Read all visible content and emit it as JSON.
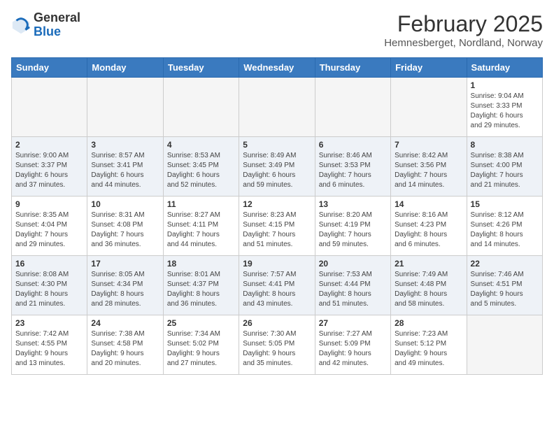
{
  "header": {
    "logo_general": "General",
    "logo_blue": "Blue",
    "month_title": "February 2025",
    "location": "Hemnesberget, Nordland, Norway"
  },
  "calendar": {
    "days_of_week": [
      "Sunday",
      "Monday",
      "Tuesday",
      "Wednesday",
      "Thursday",
      "Friday",
      "Saturday"
    ],
    "weeks": [
      [
        {
          "day": "",
          "info": ""
        },
        {
          "day": "",
          "info": ""
        },
        {
          "day": "",
          "info": ""
        },
        {
          "day": "",
          "info": ""
        },
        {
          "day": "",
          "info": ""
        },
        {
          "day": "",
          "info": ""
        },
        {
          "day": "1",
          "info": "Sunrise: 9:04 AM\nSunset: 3:33 PM\nDaylight: 6 hours\nand 29 minutes."
        }
      ],
      [
        {
          "day": "2",
          "info": "Sunrise: 9:00 AM\nSunset: 3:37 PM\nDaylight: 6 hours\nand 37 minutes."
        },
        {
          "day": "3",
          "info": "Sunrise: 8:57 AM\nSunset: 3:41 PM\nDaylight: 6 hours\nand 44 minutes."
        },
        {
          "day": "4",
          "info": "Sunrise: 8:53 AM\nSunset: 3:45 PM\nDaylight: 6 hours\nand 52 minutes."
        },
        {
          "day": "5",
          "info": "Sunrise: 8:49 AM\nSunset: 3:49 PM\nDaylight: 6 hours\nand 59 minutes."
        },
        {
          "day": "6",
          "info": "Sunrise: 8:46 AM\nSunset: 3:53 PM\nDaylight: 7 hours\nand 6 minutes."
        },
        {
          "day": "7",
          "info": "Sunrise: 8:42 AM\nSunset: 3:56 PM\nDaylight: 7 hours\nand 14 minutes."
        },
        {
          "day": "8",
          "info": "Sunrise: 8:38 AM\nSunset: 4:00 PM\nDaylight: 7 hours\nand 21 minutes."
        }
      ],
      [
        {
          "day": "9",
          "info": "Sunrise: 8:35 AM\nSunset: 4:04 PM\nDaylight: 7 hours\nand 29 minutes."
        },
        {
          "day": "10",
          "info": "Sunrise: 8:31 AM\nSunset: 4:08 PM\nDaylight: 7 hours\nand 36 minutes."
        },
        {
          "day": "11",
          "info": "Sunrise: 8:27 AM\nSunset: 4:11 PM\nDaylight: 7 hours\nand 44 minutes."
        },
        {
          "day": "12",
          "info": "Sunrise: 8:23 AM\nSunset: 4:15 PM\nDaylight: 7 hours\nand 51 minutes."
        },
        {
          "day": "13",
          "info": "Sunrise: 8:20 AM\nSunset: 4:19 PM\nDaylight: 7 hours\nand 59 minutes."
        },
        {
          "day": "14",
          "info": "Sunrise: 8:16 AM\nSunset: 4:23 PM\nDaylight: 8 hours\nand 6 minutes."
        },
        {
          "day": "15",
          "info": "Sunrise: 8:12 AM\nSunset: 4:26 PM\nDaylight: 8 hours\nand 14 minutes."
        }
      ],
      [
        {
          "day": "16",
          "info": "Sunrise: 8:08 AM\nSunset: 4:30 PM\nDaylight: 8 hours\nand 21 minutes."
        },
        {
          "day": "17",
          "info": "Sunrise: 8:05 AM\nSunset: 4:34 PM\nDaylight: 8 hours\nand 28 minutes."
        },
        {
          "day": "18",
          "info": "Sunrise: 8:01 AM\nSunset: 4:37 PM\nDaylight: 8 hours\nand 36 minutes."
        },
        {
          "day": "19",
          "info": "Sunrise: 7:57 AM\nSunset: 4:41 PM\nDaylight: 8 hours\nand 43 minutes."
        },
        {
          "day": "20",
          "info": "Sunrise: 7:53 AM\nSunset: 4:44 PM\nDaylight: 8 hours\nand 51 minutes."
        },
        {
          "day": "21",
          "info": "Sunrise: 7:49 AM\nSunset: 4:48 PM\nDaylight: 8 hours\nand 58 minutes."
        },
        {
          "day": "22",
          "info": "Sunrise: 7:46 AM\nSunset: 4:51 PM\nDaylight: 9 hours\nand 5 minutes."
        }
      ],
      [
        {
          "day": "23",
          "info": "Sunrise: 7:42 AM\nSunset: 4:55 PM\nDaylight: 9 hours\nand 13 minutes."
        },
        {
          "day": "24",
          "info": "Sunrise: 7:38 AM\nSunset: 4:58 PM\nDaylight: 9 hours\nand 20 minutes."
        },
        {
          "day": "25",
          "info": "Sunrise: 7:34 AM\nSunset: 5:02 PM\nDaylight: 9 hours\nand 27 minutes."
        },
        {
          "day": "26",
          "info": "Sunrise: 7:30 AM\nSunset: 5:05 PM\nDaylight: 9 hours\nand 35 minutes."
        },
        {
          "day": "27",
          "info": "Sunrise: 7:27 AM\nSunset: 5:09 PM\nDaylight: 9 hours\nand 42 minutes."
        },
        {
          "day": "28",
          "info": "Sunrise: 7:23 AM\nSunset: 5:12 PM\nDaylight: 9 hours\nand 49 minutes."
        },
        {
          "day": "",
          "info": ""
        }
      ]
    ]
  }
}
